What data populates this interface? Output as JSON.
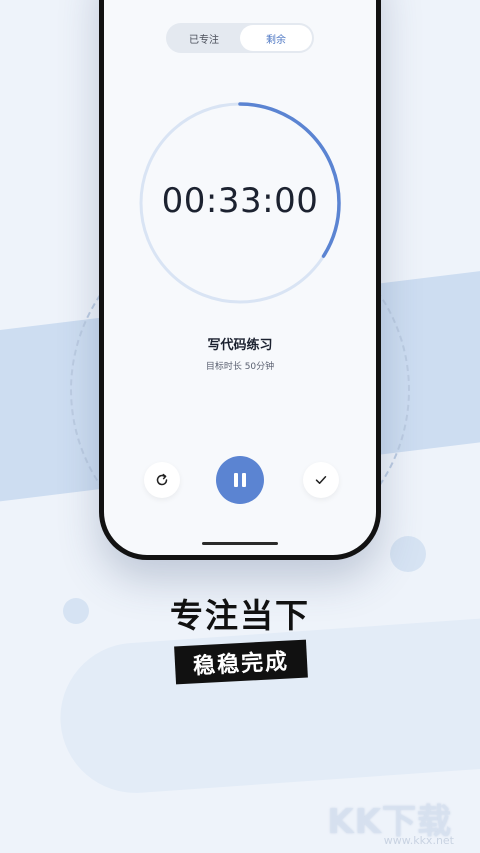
{
  "timer": {
    "tabs": [
      {
        "label": "已专注",
        "active": false
      },
      {
        "label": "剩余",
        "active": true
      }
    ],
    "time_display": "00:33:00",
    "progress_fraction": 0.34,
    "task_title": "写代码练习",
    "task_subtitle": "目标时长 50分钟",
    "controls": {
      "reset_icon": "refresh-icon",
      "pause_icon": "pause-icon",
      "done_icon": "check-icon"
    }
  },
  "promo": {
    "headline": "专注当下",
    "tag": "稳稳完成"
  },
  "watermark": {
    "brand": "KK下载",
    "url": "www.kkx.net"
  },
  "colors": {
    "accent": "#5b84d2",
    "ring_track": "#d9e4f4",
    "background": "#eef3fa"
  }
}
